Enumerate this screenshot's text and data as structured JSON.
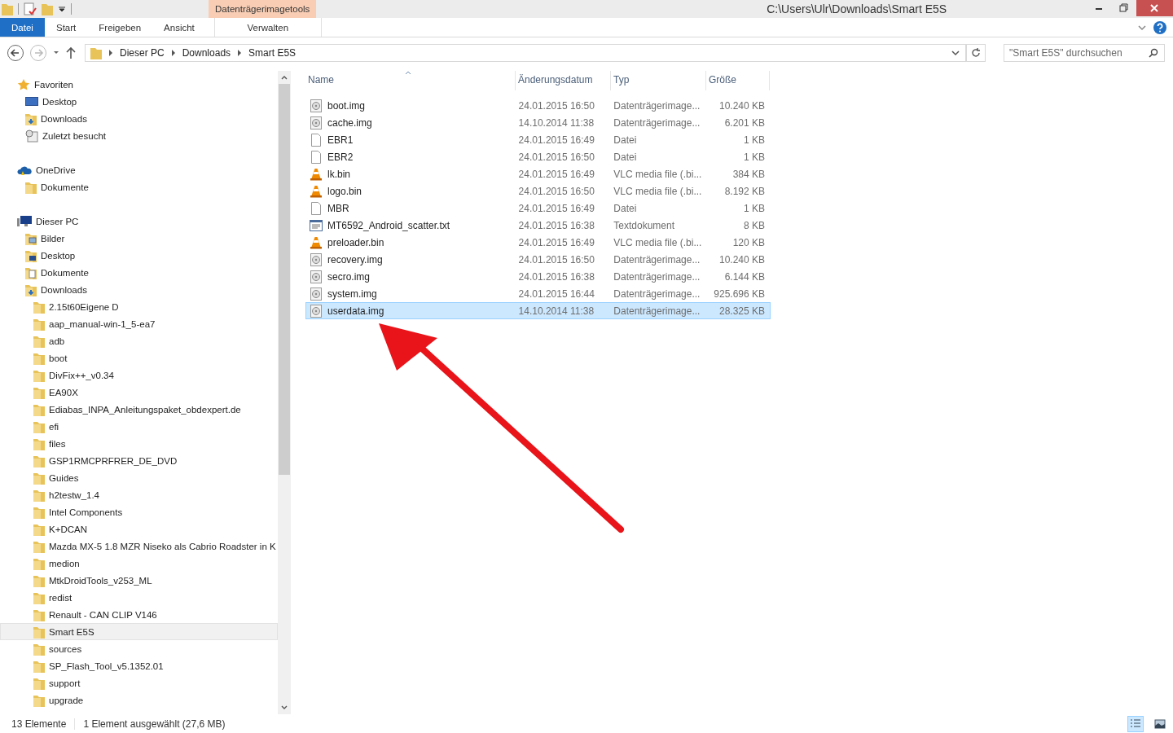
{
  "window": {
    "title": "C:\\Users\\Ulr\\Downloads\\Smart E5S",
    "context_tab": "Datenträgerimagetools"
  },
  "ribbon_tabs": [
    {
      "label": "Datei",
      "kind": "file"
    },
    {
      "label": "Start",
      "kind": "tab"
    },
    {
      "label": "Freigeben",
      "kind": "tab"
    },
    {
      "label": "Ansicht",
      "kind": "tab"
    },
    {
      "label": "Verwalten",
      "kind": "context"
    }
  ],
  "breadcrumb": [
    "Dieser PC",
    "Downloads",
    "Smart E5S"
  ],
  "search": {
    "placeholder": "\"Smart E5S\" durchsuchen"
  },
  "sidebar": [
    {
      "label": "Favoriten",
      "kind": "star",
      "selected": false,
      "children": [
        {
          "label": "Desktop",
          "kind": "desktop",
          "selected": false
        },
        {
          "label": "Downloads",
          "kind": "download",
          "selected": false
        },
        {
          "label": "Zuletzt besucht",
          "kind": "recent",
          "selected": false
        }
      ]
    },
    {
      "label": "OneDrive",
      "kind": "cloud",
      "selected": false,
      "children": [
        {
          "label": "Dokumente",
          "kind": "folder",
          "selected": false
        }
      ]
    },
    {
      "label": "Dieser PC",
      "kind": "pc",
      "selected": false,
      "children": [
        {
          "label": "Bilder",
          "kind": "pictures",
          "selected": false
        },
        {
          "label": "Desktop",
          "kind": "desktop-folder",
          "selected": false
        },
        {
          "label": "Dokumente",
          "kind": "documents",
          "selected": false
        },
        {
          "label": "Downloads",
          "kind": "download",
          "selected": false,
          "children": [
            {
              "label": "2.15t60Eigene D",
              "kind": "folder",
              "selected": false
            },
            {
              "label": "aap_manual-win-1_5-ea7",
              "kind": "folder",
              "selected": false
            },
            {
              "label": "adb",
              "kind": "folder",
              "selected": false
            },
            {
              "label": "boot",
              "kind": "folder",
              "selected": false
            },
            {
              "label": "DivFix++_v0.34",
              "kind": "folder",
              "selected": false
            },
            {
              "label": "EA90X",
              "kind": "folder",
              "selected": false
            },
            {
              "label": "Ediabas_INPA_Anleitungspaket_obdexpert.de",
              "kind": "folder",
              "selected": false
            },
            {
              "label": "efi",
              "kind": "folder",
              "selected": false
            },
            {
              "label": "files",
              "kind": "folder",
              "selected": false
            },
            {
              "label": "GSP1RMCPRFRER_DE_DVD",
              "kind": "folder",
              "selected": false
            },
            {
              "label": "Guides",
              "kind": "folder",
              "selected": false
            },
            {
              "label": "h2testw_1.4",
              "kind": "folder",
              "selected": false
            },
            {
              "label": "Intel Components",
              "kind": "folder",
              "selected": false
            },
            {
              "label": "K+DCAN",
              "kind": "folder",
              "selected": false
            },
            {
              "label": "Mazda MX-5 1.8 MZR Niseko als Cabrio Roadster in K",
              "kind": "folder",
              "selected": false
            },
            {
              "label": "medion",
              "kind": "folder",
              "selected": false
            },
            {
              "label": "MtkDroidTools_v253_ML",
              "kind": "folder",
              "selected": false
            },
            {
              "label": "redist",
              "kind": "folder",
              "selected": false
            },
            {
              "label": "Renault - CAN CLIP V146",
              "kind": "folder",
              "selected": false
            },
            {
              "label": "Smart E5S",
              "kind": "folder",
              "selected": true
            },
            {
              "label": "sources",
              "kind": "folder",
              "selected": false
            },
            {
              "label": "SP_Flash_Tool_v5.1352.01",
              "kind": "folder",
              "selected": false
            },
            {
              "label": "support",
              "kind": "folder",
              "selected": false
            },
            {
              "label": "upgrade",
              "kind": "folder",
              "selected": false
            }
          ]
        }
      ]
    }
  ],
  "columns": [
    "Name",
    "Änderungsdatum",
    "Typ",
    "Größe"
  ],
  "files": [
    {
      "name": "boot.img",
      "date": "24.01.2015 16:50",
      "type": "Datenträgerimage...",
      "size": "10.240 KB",
      "kind": "disc",
      "selected": false
    },
    {
      "name": "cache.img",
      "date": "14.10.2014 11:38",
      "type": "Datenträgerimage...",
      "size": "6.201 KB",
      "kind": "disc",
      "selected": false
    },
    {
      "name": "EBR1",
      "date": "24.01.2015 16:49",
      "type": "Datei",
      "size": "1 KB",
      "kind": "blank",
      "selected": false
    },
    {
      "name": "EBR2",
      "date": "24.01.2015 16:50",
      "type": "Datei",
      "size": "1 KB",
      "kind": "blank",
      "selected": false
    },
    {
      "name": "lk.bin",
      "date": "24.01.2015 16:49",
      "type": "VLC media file (.bi...",
      "size": "384 KB",
      "kind": "cone",
      "selected": false
    },
    {
      "name": "logo.bin",
      "date": "24.01.2015 16:50",
      "type": "VLC media file (.bi...",
      "size": "8.192 KB",
      "kind": "cone",
      "selected": false
    },
    {
      "name": "MBR",
      "date": "24.01.2015 16:49",
      "type": "Datei",
      "size": "1 KB",
      "kind": "blank",
      "selected": false
    },
    {
      "name": "MT6592_Android_scatter.txt",
      "date": "24.01.2015 16:38",
      "type": "Textdokument",
      "size": "8 KB",
      "kind": "text",
      "selected": false
    },
    {
      "name": "preloader.bin",
      "date": "24.01.2015 16:49",
      "type": "VLC media file (.bi...",
      "size": "120 KB",
      "kind": "cone",
      "selected": false
    },
    {
      "name": "recovery.img",
      "date": "24.01.2015 16:50",
      "type": "Datenträgerimage...",
      "size": "10.240 KB",
      "kind": "disc",
      "selected": false
    },
    {
      "name": "secro.img",
      "date": "24.01.2015 16:38",
      "type": "Datenträgerimage...",
      "size": "6.144 KB",
      "kind": "disc",
      "selected": false
    },
    {
      "name": "system.img",
      "date": "24.01.2015 16:44",
      "type": "Datenträgerimage...",
      "size": "925.696 KB",
      "kind": "disc",
      "selected": false
    },
    {
      "name": "userdata.img",
      "date": "14.10.2014 11:38",
      "type": "Datenträgerimage...",
      "size": "28.325 KB",
      "kind": "disc",
      "selected": true
    }
  ],
  "status_bar": {
    "count": "13 Elemente",
    "selection": "1 Element ausgewählt (27,6 MB)"
  },
  "view_buttons": [
    {
      "kind": "details",
      "selected": true
    },
    {
      "kind": "thumbnails",
      "selected": false
    }
  ]
}
